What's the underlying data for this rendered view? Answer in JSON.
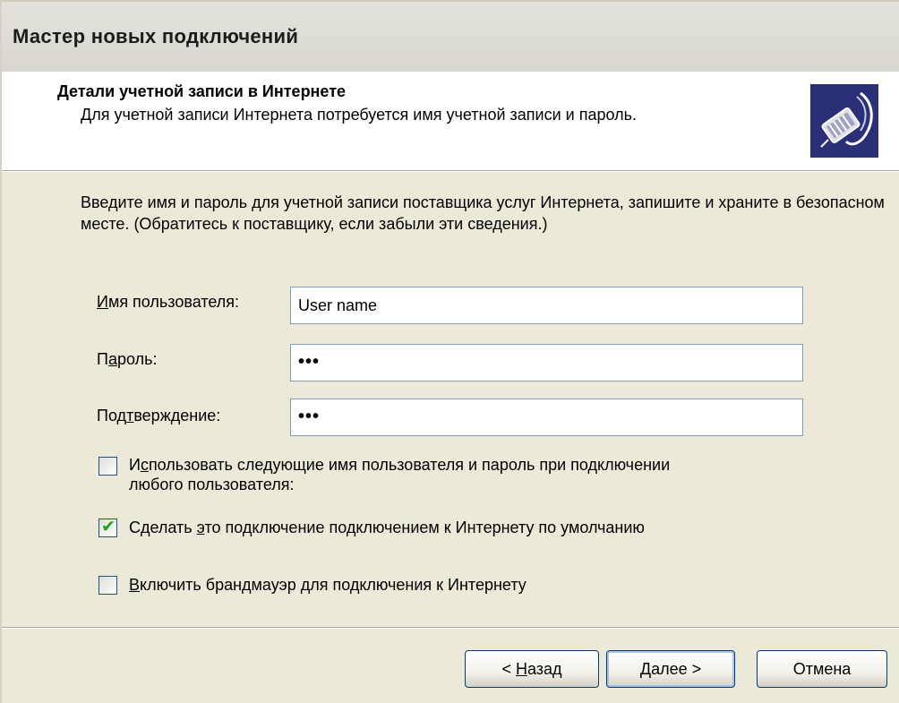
{
  "window": {
    "title": "Мастер новых подключений"
  },
  "header": {
    "title": "Детали учетной записи в Интернете",
    "subtitle": "Для учетной записи Интернета потребуется имя учетной записи и пароль.",
    "icon": "network-cable-icon"
  },
  "main": {
    "instructions": "Введите имя и пароль для учетной записи поставщика услуг Интернета, запишите и храните в безопасном месте. (Обратитесь к поставщику, если забыли эти сведения.)",
    "fields": {
      "username": {
        "label_pre": "",
        "label_key": "И",
        "label_post": "мя пользователя:",
        "value": "User name"
      },
      "password": {
        "label_pre": "П",
        "label_key": "а",
        "label_post": "роль:",
        "value": "•••"
      },
      "confirm": {
        "label_pre": "Под",
        "label_key": "т",
        "label_post": "верждение:",
        "value": "•••"
      }
    },
    "checkboxes": {
      "use_for_all": {
        "checked": false,
        "label_pre": "И",
        "label_key": "с",
        "label_post": "пользовать следующие имя пользователя и пароль при подключении",
        "label_line2": "любого пользователя:"
      },
      "default_connection": {
        "checked": true,
        "label_pre": "Сделать ",
        "label_key": "э",
        "label_post": "то подключение подключением к Интернету по умолчанию"
      },
      "firewall": {
        "checked": false,
        "label_pre": "",
        "label_key": "В",
        "label_post": "ключить брандмауэр для подключения к Интернету"
      }
    }
  },
  "footer": {
    "back": {
      "pre": "< ",
      "key": "Н",
      "post": "азад"
    },
    "next": {
      "pre": "",
      "key": "Д",
      "post": "алее >"
    },
    "cancel": "Отмена"
  },
  "colors": {
    "dialog_bg": "#ece9d8",
    "header_bg": "#ffffff",
    "input_border": "#7f9db9",
    "button_border": "#003c74",
    "check_mark": "#21a121",
    "icon_bg": "#2a2f78"
  }
}
